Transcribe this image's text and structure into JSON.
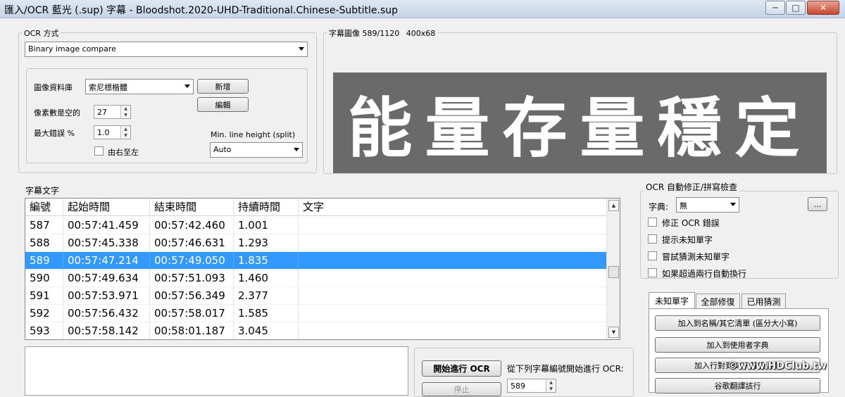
{
  "window": {
    "title": "匯入/OCR 藍光 (.sup) 字幕 - Bloodshot.2020-UHD-Traditional.Chinese-Subtitle.sup",
    "minimize_glyph": "─",
    "maximize_glyph": "□",
    "close_glyph": "✕"
  },
  "ocr_method": {
    "group_label": "OCR 方式",
    "method_value": "Binary image compare",
    "db_label": "圖像資料庫",
    "db_value": "索尼標楷體",
    "new_button": "新增",
    "edit_button": "編輯",
    "pixels_space_label": "像素數是空的",
    "pixels_space_value": "27",
    "max_error_label": "最大錯誤 %",
    "max_error_value": "1.0",
    "rtl_label": "由右至左",
    "min_line_height_label": "Min. line height (split)",
    "min_line_height_value": "Auto"
  },
  "subtitle_image": {
    "group_label": "字幕圖像",
    "index_info": "589/1120",
    "size_info": "400x68",
    "image_text": "能量存量穩定"
  },
  "subtitle_text": {
    "group_label": "字幕文字",
    "columns": [
      "編號",
      "起始時間",
      "結束時間",
      "持續時間",
      "文字"
    ],
    "rows": [
      {
        "num": "587",
        "start": "00:57:41.459",
        "end": "00:57:42.460",
        "dur": "1.001",
        "text": ""
      },
      {
        "num": "588",
        "start": "00:57:45.338",
        "end": "00:57:46.631",
        "dur": "1.293",
        "text": ""
      },
      {
        "num": "589",
        "start": "00:57:47.214",
        "end": "00:57:49.050",
        "dur": "1.835",
        "text": ""
      },
      {
        "num": "590",
        "start": "00:57:49.634",
        "end": "00:57:51.093",
        "dur": "1.460",
        "text": ""
      },
      {
        "num": "591",
        "start": "00:57:53.971",
        "end": "00:57:56.349",
        "dur": "2.377",
        "text": ""
      },
      {
        "num": "592",
        "start": "00:57:56.432",
        "end": "00:57:58.017",
        "dur": "1.585",
        "text": ""
      },
      {
        "num": "593",
        "start": "00:57:58.142",
        "end": "00:58:01.187",
        "dur": "3.045",
        "text": ""
      }
    ],
    "selected_index": 2,
    "selection_color": "#3399ff"
  },
  "ocr_autocorrect": {
    "group_label": "OCR 自動修正/拼寫檢查",
    "dictionary_label": "字典:",
    "dictionary_value": "無",
    "browse_button": "...",
    "checkboxes": [
      "修正 OCR 錯誤",
      "提示未知單字",
      "嘗試猜測未知單字",
      "如果超過兩行自動換行"
    ]
  },
  "tabs": [
    "未知單字",
    "全部修復",
    "已用猜測"
  ],
  "unknown_words": {
    "buttons": [
      "加入到名稱/其它清單 (區分大小寫)",
      "加入到使用者字典",
      "加入行對到OCR替換清單",
      "谷歌翻譯該行"
    ]
  },
  "ocr_controls": {
    "start_button": "開始進行 OCR",
    "stop_button": "停止",
    "start_from_label": "從下列字幕編號開始進行 OCR:",
    "start_from_value": "589"
  },
  "watermark": "©www.HDClub.tw"
}
